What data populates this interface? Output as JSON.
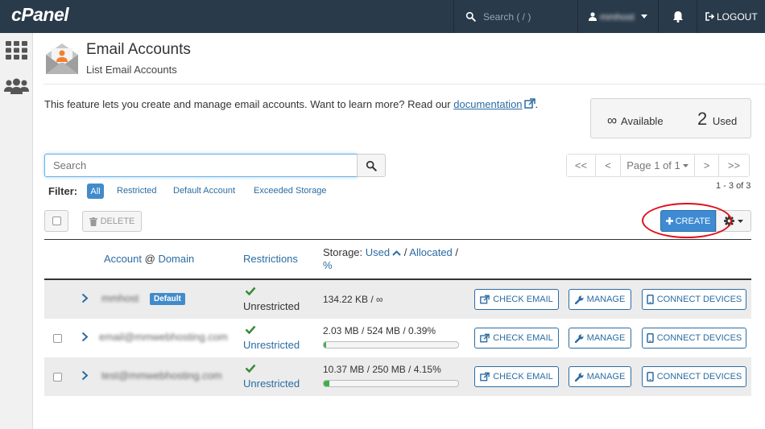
{
  "topbar": {
    "logo": "cPanel",
    "search_placeholder": "Search ( / )",
    "username": "mmhost",
    "logout_label": "LOGOUT"
  },
  "sidebar": {
    "icons": [
      "apps-grid-icon",
      "users-icon"
    ]
  },
  "page": {
    "title": "Email Accounts",
    "subtitle": "List Email Accounts",
    "intro_text": "This feature lets you create and manage email accounts. Want to learn more? Read our",
    "intro_link": "documentation",
    "intro_end": "."
  },
  "stats": {
    "available_symbol": "∞",
    "available_label": "Available",
    "used_count": "2",
    "used_label": "Used"
  },
  "search": {
    "placeholder": "Search"
  },
  "pager": {
    "first": "<<",
    "prev": "<",
    "page_label": "Page 1 of 1",
    "next": ">",
    "last": ">>",
    "range": "1 - 3 of 3"
  },
  "filter": {
    "label": "Filter:",
    "options": [
      "All",
      "Restricted",
      "Default Account",
      "Exceeded Storage"
    ],
    "active": "All"
  },
  "toolbar": {
    "delete_label": "DELETE",
    "create_label": "CREATE"
  },
  "table": {
    "col_account": "Account",
    "col_at": "@",
    "col_domain": "Domain",
    "col_restrictions": "Restrictions",
    "col_storage_prefix": "Storage:",
    "col_used": "Used",
    "col_sep1": "/",
    "col_allocated": "Allocated",
    "col_sep2": "/",
    "col_percent": "%",
    "rows": [
      {
        "account": "mmhost",
        "badge": "Default",
        "restriction": "Unrestricted",
        "storage": "134.22 KB / ∞",
        "usage_fraction": null
      },
      {
        "account": "email@mmwebhosting.com",
        "badge": "",
        "restriction": "Unrestricted",
        "storage": "2.03 MB / 524 MB / 0.39%",
        "usage_fraction": 0.0039
      },
      {
        "account": "test@mmwebhosting.com",
        "badge": "",
        "restriction": "Unrestricted",
        "storage": "10.37 MB / 250 MB / 4.15%",
        "usage_fraction": 0.0415
      }
    ],
    "actions": {
      "check_email": "CHECK EMAIL",
      "manage": "MANAGE",
      "connect_devices": "CONNECT DEVICES"
    }
  },
  "colors": {
    "topbar_bg": "#293a4a",
    "accent_blue": "#3e8bd3",
    "link_blue": "#2b6ca3",
    "success_green": "#3cb14a",
    "highlight_red": "#e0101a"
  }
}
